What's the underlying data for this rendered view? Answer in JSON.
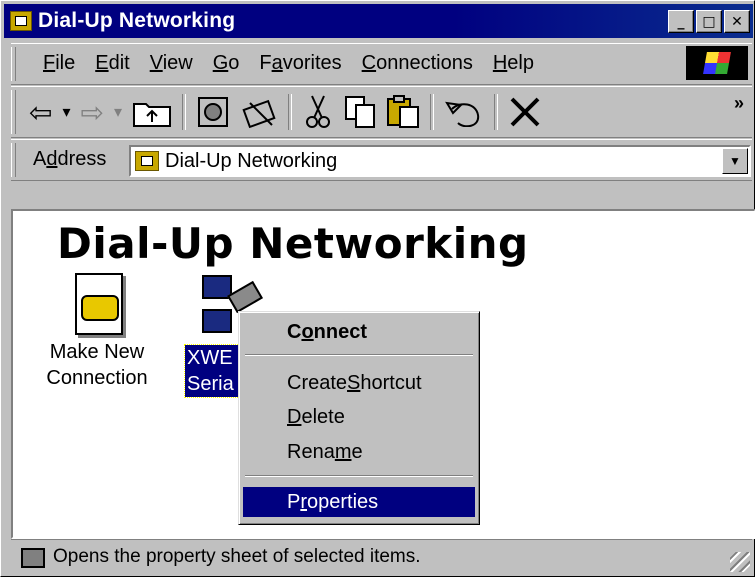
{
  "window": {
    "title": "Dial-Up Networking",
    "minimize": "_",
    "maximize": "□",
    "close": "✕"
  },
  "menu": {
    "items": [
      {
        "key": "F",
        "rest": "ile"
      },
      {
        "key": "E",
        "rest": "dit"
      },
      {
        "key": "V",
        "rest": "iew"
      },
      {
        "key": "G",
        "rest": "o"
      },
      {
        "pre": "F",
        "key": "a",
        "rest": "vorites"
      },
      {
        "key": "C",
        "rest": "onnections"
      },
      {
        "key": "H",
        "rest": "elp"
      }
    ]
  },
  "toolbar": {
    "back": "⇦",
    "back_drop": "▾",
    "forward": "⇨",
    "forward_drop": "▾",
    "up": "⮤",
    "more": "»"
  },
  "address": {
    "label_pre": "A",
    "label_key": "d",
    "label_rest": "dress",
    "value": "Dial-Up Networking",
    "dropdown": "▼"
  },
  "content": {
    "heading": "Dial-Up Networking",
    "items": [
      {
        "label": "Make New\nConnection"
      },
      {
        "label": "XWE\nSeria"
      }
    ]
  },
  "context_menu": {
    "connect": {
      "pre": "C",
      "key": "o",
      "rest": "nnect"
    },
    "create_shortcut": {
      "pre": "Create ",
      "key": "S",
      "rest": "hortcut"
    },
    "delete": {
      "pre": "",
      "key": "D",
      "rest": "elete"
    },
    "rename": {
      "pre": "Rena",
      "key": "m",
      "rest": "e"
    },
    "properties": {
      "pre": "P",
      "key": "r",
      "rest": "operties"
    }
  },
  "status": {
    "text": "Opens the property sheet of selected items."
  }
}
